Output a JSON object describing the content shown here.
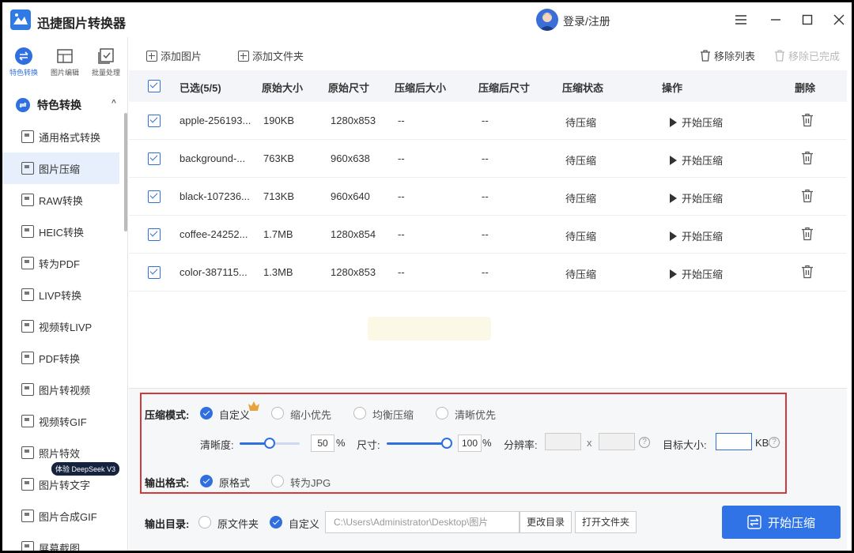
{
  "app": {
    "title": "迅捷图片转换器",
    "login": "登录/注册"
  },
  "top_tabs": [
    {
      "label": "特色转换",
      "active": true
    },
    {
      "label": "图片编辑",
      "active": false
    },
    {
      "label": "批量处理",
      "active": false
    }
  ],
  "sidebar": {
    "header": "特色转换",
    "items": [
      {
        "label": "通用格式转换"
      },
      {
        "label": "图片压缩",
        "active": true
      },
      {
        "label": "RAW转换"
      },
      {
        "label": "HEIC转换"
      },
      {
        "label": "转为PDF"
      },
      {
        "label": "LIVP转换"
      },
      {
        "label": "视频转LIVP"
      },
      {
        "label": "PDF转换"
      },
      {
        "label": "图片转视频"
      },
      {
        "label": "视频转GIF"
      },
      {
        "label": "照片特效"
      },
      {
        "label": "图片转文字"
      },
      {
        "label": "图片合成GIF"
      },
      {
        "label": "屏幕截图"
      }
    ],
    "badge": "体验 DeepSeek V3"
  },
  "toolbar": {
    "add_image": "添加图片",
    "add_folder": "添加文件夹",
    "remove_list": "移除列表",
    "remove_done": "移除已完成"
  },
  "table": {
    "headers": {
      "selected": "已选(5/5)",
      "orig_size": "原始大小",
      "orig_dim": "原始尺寸",
      "comp_size": "压缩后大小",
      "comp_dim": "压缩后尺寸",
      "status": "压缩状态",
      "action": "操作",
      "delete": "删除"
    },
    "rows": [
      {
        "name": "apple-256193...",
        "size": "190KB",
        "dim": "1280x853",
        "csize": "--",
        "cdim": "--",
        "status": "待压缩",
        "action": "开始压缩"
      },
      {
        "name": "background-...",
        "size": "763KB",
        "dim": "960x638",
        "csize": "--",
        "cdim": "--",
        "status": "待压缩",
        "action": "开始压缩"
      },
      {
        "name": "black-107236...",
        "size": "713KB",
        "dim": "960x640",
        "csize": "--",
        "cdim": "--",
        "status": "待压缩",
        "action": "开始压缩"
      },
      {
        "name": "coffee-24252...",
        "size": "1.7MB",
        "dim": "1280x854",
        "csize": "--",
        "cdim": "--",
        "status": "待压缩",
        "action": "开始压缩"
      },
      {
        "name": "color-387115...",
        "size": "1.3MB",
        "dim": "1280x853",
        "csize": "--",
        "cdim": "--",
        "status": "待压缩",
        "action": "开始压缩"
      }
    ]
  },
  "settings": {
    "mode_label": "压缩模式:",
    "modes": [
      "自定义",
      "缩小优先",
      "均衡压缩",
      "清晰优先"
    ],
    "clarity_label": "清晰度:",
    "clarity_value": "50",
    "clarity_percent": 50,
    "percent": "%",
    "size_label": "尺寸:",
    "size_value": "100",
    "size_percent": 100,
    "resolution_label": "分辨率:",
    "x": "x",
    "target_label": "目标大小:",
    "kb": "KB",
    "format_label": "输出格式:",
    "formats": [
      "原格式",
      "转为JPG"
    ],
    "output_label": "输出目录:",
    "outputs": [
      "原文件夹",
      "自定义"
    ],
    "path": "C:\\Users\\Administrator\\Desktop\\图片",
    "change_dir": "更改目录",
    "open_folder": "打开文件夹",
    "start": "开始压缩"
  },
  "colors": {
    "accent": "#2f73e6",
    "highlight_box": "#d23a3a"
  }
}
